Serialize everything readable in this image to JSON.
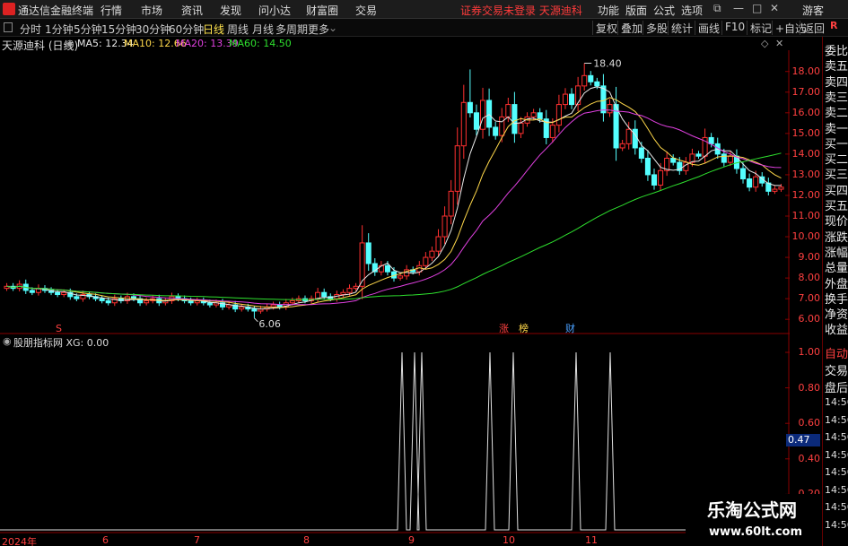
{
  "titlebar": {
    "app_name": "通达信金融终端",
    "menu": [
      "行情",
      "市场",
      "资讯",
      "发现",
      "问小达",
      "财富圈",
      "交易"
    ],
    "warning": "证券交易未登录  天源迪科",
    "right_menu": [
      "功能",
      "版面",
      "公式",
      "选项"
    ],
    "user": "游客",
    "window_buttons": [
      "⧉",
      "—",
      "□",
      "✕"
    ]
  },
  "periodbar": {
    "periods": [
      "分时",
      "1分钟",
      "5分钟",
      "15分钟",
      "30分钟",
      "60分钟",
      "日线",
      "周线",
      "月线",
      "多周期",
      "更多"
    ],
    "active_period": "日线",
    "tools": [
      "复权",
      "叠加",
      "多股",
      "统计",
      "画线",
      "F10",
      "标记",
      "+自选",
      "返回"
    ]
  },
  "main_chart": {
    "stock_title": "天源迪科 (日线)",
    "ma": [
      {
        "label": "MA5: 12.34",
        "color": "#e8e8e8"
      },
      {
        "label": "MA10: 12.66",
        "color": "#ffd84a"
      },
      {
        "label": "MA20: 13.39",
        "color": "#e040e0"
      },
      {
        "label": "MA60: 14.50",
        "color": "#2ee02e"
      }
    ],
    "high_marker": "18.40",
    "low_marker": "6.06",
    "y_ticks": [
      "18.00",
      "17.00",
      "16.00",
      "15.00",
      "14.00",
      "13.00",
      "12.00",
      "11.00",
      "10.00",
      "9.00",
      "8.00",
      "7.00",
      "6.00"
    ],
    "event_marks": [
      {
        "label": "S",
        "color": "#ff4040"
      },
      {
        "label": "涨",
        "color": "#ff4040"
      },
      {
        "label": "榜",
        "color": "#ffd84a"
      },
      {
        "label": "财",
        "color": "#4aa0ff"
      }
    ]
  },
  "sub_chart": {
    "indicator_title": "股朋指标网 XG: 0.00",
    "y_ticks": [
      "1.00",
      "0.80",
      "0.60",
      "0.40",
      "0.20"
    ],
    "current_value": "0.47"
  },
  "x_axis": [
    "2024年",
    "6",
    "7",
    "8",
    "9",
    "10",
    "11"
  ],
  "right_panel": {
    "labels": [
      "委比",
      "卖五",
      "卖四",
      "卖三",
      "卖二",
      "卖一",
      "买一",
      "买二",
      "买三",
      "买四",
      "买五",
      "现价",
      "涨跌",
      "涨幅",
      "总量",
      "外盘",
      "换手",
      "净资",
      "收益"
    ],
    "sub_labels": [
      "自动",
      "交易",
      "盘后"
    ],
    "times": [
      "14:56",
      "14:56",
      "14:56",
      "14:56",
      "14:56",
      "14:56",
      "14:56",
      "14:56"
    ],
    "top_badge": "R"
  },
  "watermark": {
    "line1": "乐淘公式网",
    "line2": "www.60lt.com"
  },
  "chart_data": {
    "type": "candlestick",
    "title": "天源迪科 (日线)",
    "ylim": [
      5.4,
      18.9
    ],
    "closes": [
      7.6,
      7.5,
      7.7,
      7.4,
      7.3,
      7.5,
      7.4,
      7.3,
      7.2,
      7.3,
      7.1,
      7.0,
      7.2,
      7.1,
      7.0,
      6.9,
      6.8,
      7.0,
      6.9,
      7.1,
      7.0,
      6.8,
      6.9,
      7.0,
      6.8,
      6.9,
      7.1,
      7.0,
      6.9,
      6.8,
      6.9,
      6.8,
      6.7,
      6.8,
      6.6,
      6.7,
      6.5,
      6.6,
      6.5,
      6.4,
      6.5,
      6.6,
      6.7,
      6.6,
      6.8,
      6.9,
      7.0,
      6.9,
      7.0,
      7.3,
      7.1,
      7.0,
      7.2,
      7.3,
      7.5,
      7.6,
      9.7,
      8.7,
      8.3,
      8.6,
      8.3,
      8.0,
      8.1,
      8.4,
      8.3,
      8.6,
      9.0,
      9.3,
      10.0,
      11.0,
      12.2,
      14.4,
      16.5,
      16.0,
      15.2,
      16.6,
      15.3,
      14.9,
      15.8,
      16.4,
      15.0,
      15.5,
      15.8,
      16.0,
      15.7,
      14.8,
      15.4,
      16.4,
      16.9,
      16.4,
      17.3,
      17.8,
      17.5,
      17.3,
      16.0,
      16.4,
      14.3,
      14.5,
      15.2,
      14.3,
      13.8,
      13.0,
      12.5,
      13.2,
      13.8,
      13.6,
      13.2,
      13.6,
      14.0,
      13.9,
      14.8,
      14.5,
      14.0,
      13.6,
      13.9,
      13.3,
      12.8,
      12.4,
      12.9,
      12.6,
      12.2,
      12.3,
      12.4
    ],
    "ma_series": [
      "MA5",
      "MA10",
      "MA20",
      "MA60"
    ]
  }
}
